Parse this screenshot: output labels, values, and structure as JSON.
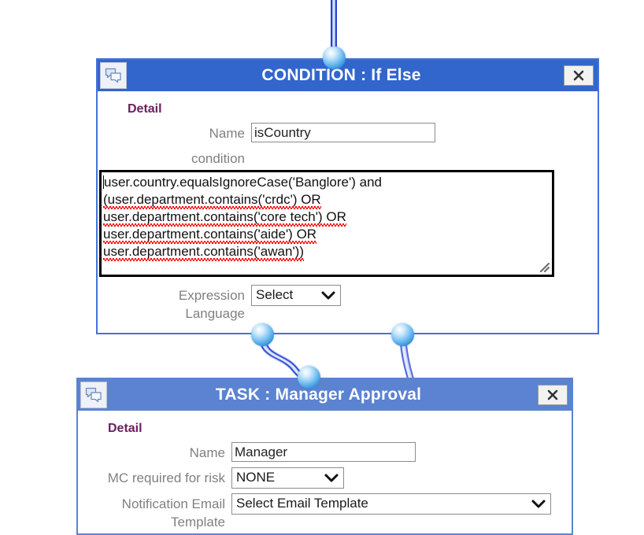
{
  "canvas": {
    "background": "#ffffff",
    "accent_border": "#4472d8",
    "active_titlebar_color": "#3366cc",
    "inactive_titlebar_color": "#5b83d1",
    "detail_heading_color": "#6b2060",
    "label_color": "#808080",
    "connector_color": "#3a5fd0"
  },
  "condition_panel": {
    "icon": "chat-bubbles-icon",
    "title": "CONDITION : If Else",
    "close_label": "✕",
    "detail_heading": "Detail",
    "fields": {
      "name_label": "Name",
      "name_value": "isCountry",
      "condition_label": "condition",
      "condition_lines": [
        "user.country.equalsIgnoreCase('Banglore') and",
        "(user.department.contains('crdc') OR",
        "user.department.contains('core tech') OR",
        "user.department.contains('aide') OR",
        "user.department.contains('awan'))"
      ],
      "condition_value": "user.country.equalsIgnoreCase('Banglore') and (user.department.contains('crdc') OR user.department.contains('core tech') OR user.department.contains('aide') OR user.department.contains('awan'))",
      "expression_language_label": "Expression\nLanguage",
      "expression_language_value": "Select"
    }
  },
  "task_panel": {
    "icon": "chat-bubbles-icon",
    "title": "TASK : Manager Approval",
    "close_label": "✕",
    "detail_heading": "Detail",
    "fields": {
      "name_label": "Name",
      "name_value": "Manager",
      "mc_risk_label": "MC required for risk",
      "mc_risk_value": "NONE",
      "notification_label": "Notification Email\nTemplate",
      "notification_value": "Select Email Template"
    }
  },
  "connectors": [
    {
      "name": "condition-top-port"
    },
    {
      "name": "condition-bottom-left-port"
    },
    {
      "name": "condition-bottom-right-port"
    },
    {
      "name": "task-top-port"
    }
  ]
}
